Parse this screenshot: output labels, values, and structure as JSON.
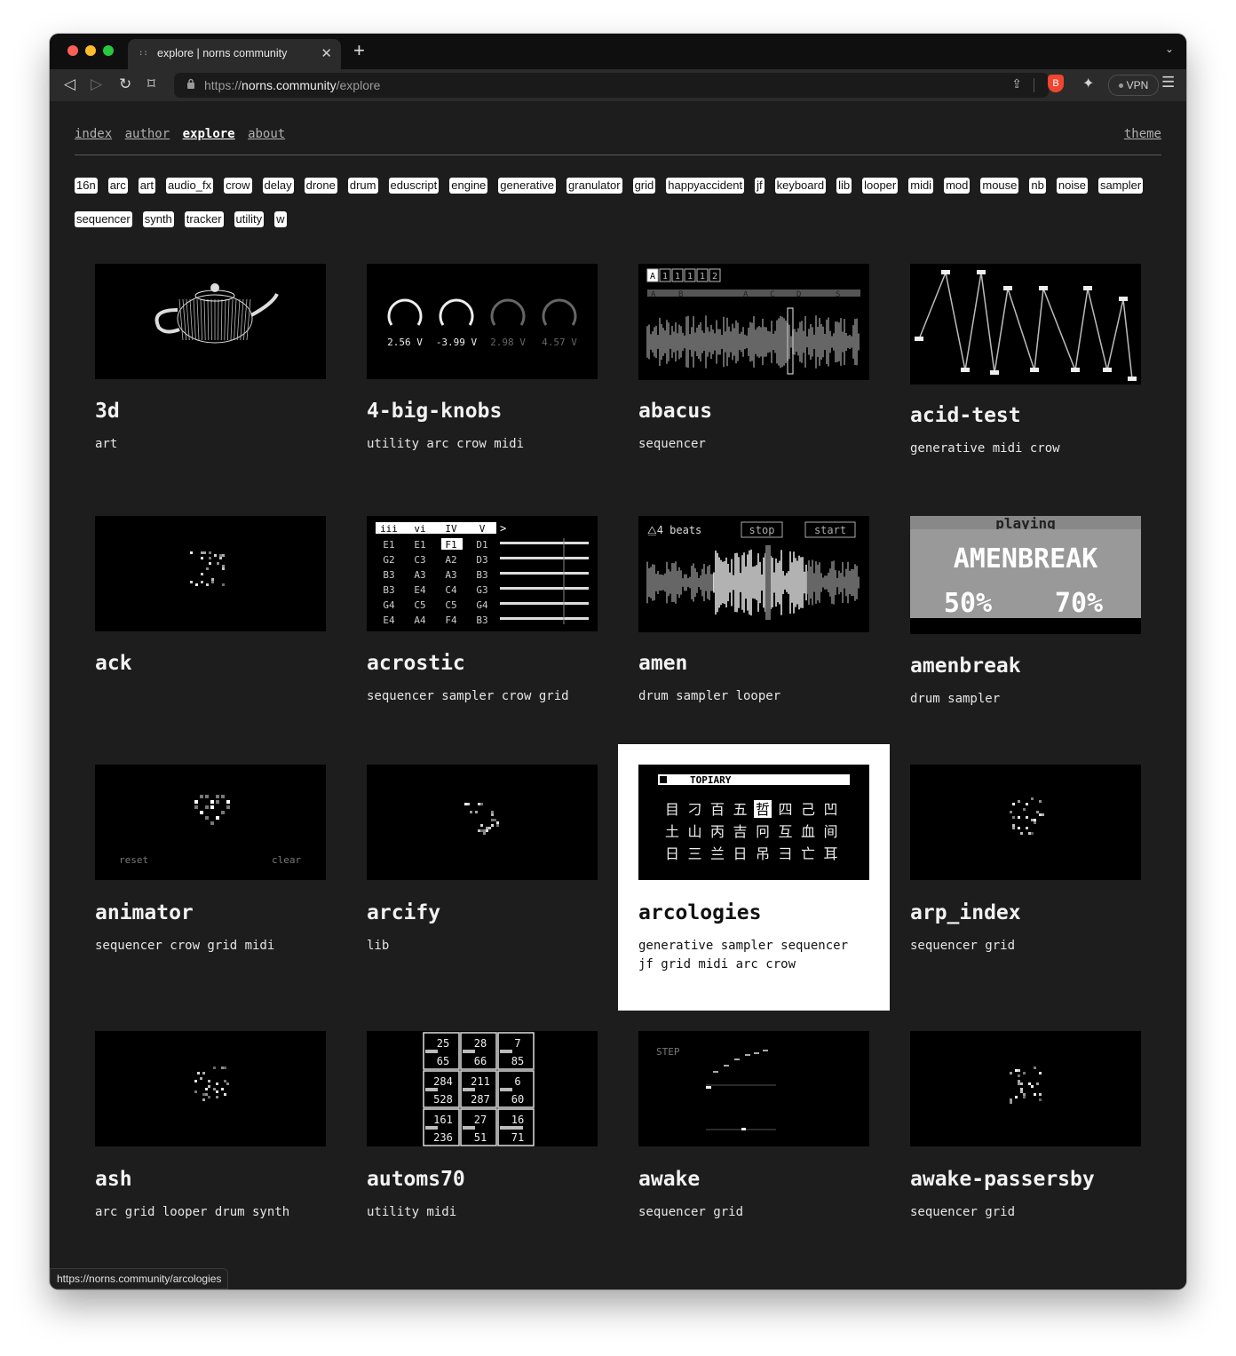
{
  "browser": {
    "tab_title": "explore | norns community",
    "tab_favicon": "::",
    "url_scheme": "https://",
    "url_host": "norns.community",
    "url_path": "/explore",
    "vpn_label": "VPN",
    "status_url": "https://norns.community/arcologies",
    "icons": {
      "back": "◁",
      "forward": "▷",
      "reload": "↻",
      "bookmark": "⌑",
      "lock": "🔒",
      "share": "⇪",
      "extensions": "✦",
      "menu": "☰",
      "close": "✕",
      "new_tab": "+",
      "dropdown": "⌄",
      "brave": "B"
    }
  },
  "nav": {
    "links": [
      "index",
      "author",
      "explore",
      "about"
    ],
    "active": "explore",
    "theme": "theme"
  },
  "tags": [
    "16n",
    "arc",
    "art",
    "audio_fx",
    "crow",
    "delay",
    "drone",
    "drum",
    "eduscript",
    "engine",
    "generative",
    "granulator",
    "grid",
    "happyaccident",
    "jf",
    "keyboard",
    "lib",
    "looper",
    "midi",
    "mod",
    "mouse",
    "nb",
    "noise",
    "sampler",
    "sequencer",
    "synth",
    "tracker",
    "utility",
    "w"
  ],
  "scripts": [
    {
      "name": "3d",
      "tags": "art"
    },
    {
      "name": "4-big-knobs",
      "tags": "utility arc crow midi"
    },
    {
      "name": "abacus",
      "tags": "sequencer"
    },
    {
      "name": "acid-test",
      "tags": "generative midi crow"
    },
    {
      "name": "ack",
      "tags": ""
    },
    {
      "name": "acrostic",
      "tags": "sequencer sampler crow grid"
    },
    {
      "name": "amen",
      "tags": "drum sampler looper"
    },
    {
      "name": "amenbreak",
      "tags": "drum sampler"
    },
    {
      "name": "animator",
      "tags": "sequencer crow grid midi"
    },
    {
      "name": "arcify",
      "tags": "lib"
    },
    {
      "name": "arcologies",
      "tags": "generative sampler sequencer jf grid midi arc crow"
    },
    {
      "name": "arp_index",
      "tags": "sequencer grid"
    },
    {
      "name": "ash",
      "tags": "arc grid looper drum synth"
    },
    {
      "name": "automs70",
      "tags": "utility midi"
    },
    {
      "name": "awake",
      "tags": "sequencer grid"
    },
    {
      "name": "awake-passersby",
      "tags": "sequencer grid"
    }
  ],
  "thumbs": {
    "knobs": [
      "2.56 V",
      "-3.99 V",
      "2.98 V",
      "4.57 V"
    ],
    "abacus_header": [
      "A",
      "1",
      "1",
      "1",
      "1",
      "2"
    ],
    "abacus_marks": [
      "A",
      "B",
      "A",
      "C",
      "D",
      "S"
    ],
    "acrostic_head": [
      "iii",
      "vi",
      "IV",
      "V"
    ],
    "acrostic_rows": [
      [
        "E1",
        "E1",
        "F1",
        "D1"
      ],
      [
        "G2",
        "C3",
        "A2",
        "D3"
      ],
      [
        "B3",
        "A3",
        "A3",
        "B3"
      ],
      [
        "B3",
        "E4",
        "C4",
        "G3"
      ],
      [
        "G4",
        "C5",
        "C5",
        "G4"
      ],
      [
        "E4",
        "A4",
        "F4",
        "B3"
      ]
    ],
    "amen_beats": "4 beats",
    "amen_stop": "stop",
    "amen_start": "start",
    "amenbreak_top": "playing",
    "amenbreak_name": "AMENBREAK",
    "amenbreak_pct": [
      "50%",
      "70%"
    ],
    "animator_reset": "reset",
    "animator_clear": "clear",
    "arcologies_title": "TOPIARY",
    "arcologies_glyphs": [
      "目",
      "刁",
      "百",
      "五",
      "哲",
      "四",
      "己",
      "凹",
      "土",
      "山",
      "丙",
      "吉",
      "冋",
      "互",
      "血",
      "间",
      "日",
      "三",
      "兰",
      "日",
      "吊",
      "彐",
      "亡",
      "耳"
    ],
    "automs": [
      [
        "25",
        "65"
      ],
      [
        "28",
        "66"
      ],
      [
        "7",
        "85"
      ],
      [
        "284",
        "528"
      ],
      [
        "211",
        "287"
      ],
      [
        "6",
        "60"
      ],
      [
        "161",
        "236"
      ],
      [
        "27",
        "51"
      ],
      [
        "16",
        "71"
      ]
    ],
    "awake_step": "STEP"
  }
}
